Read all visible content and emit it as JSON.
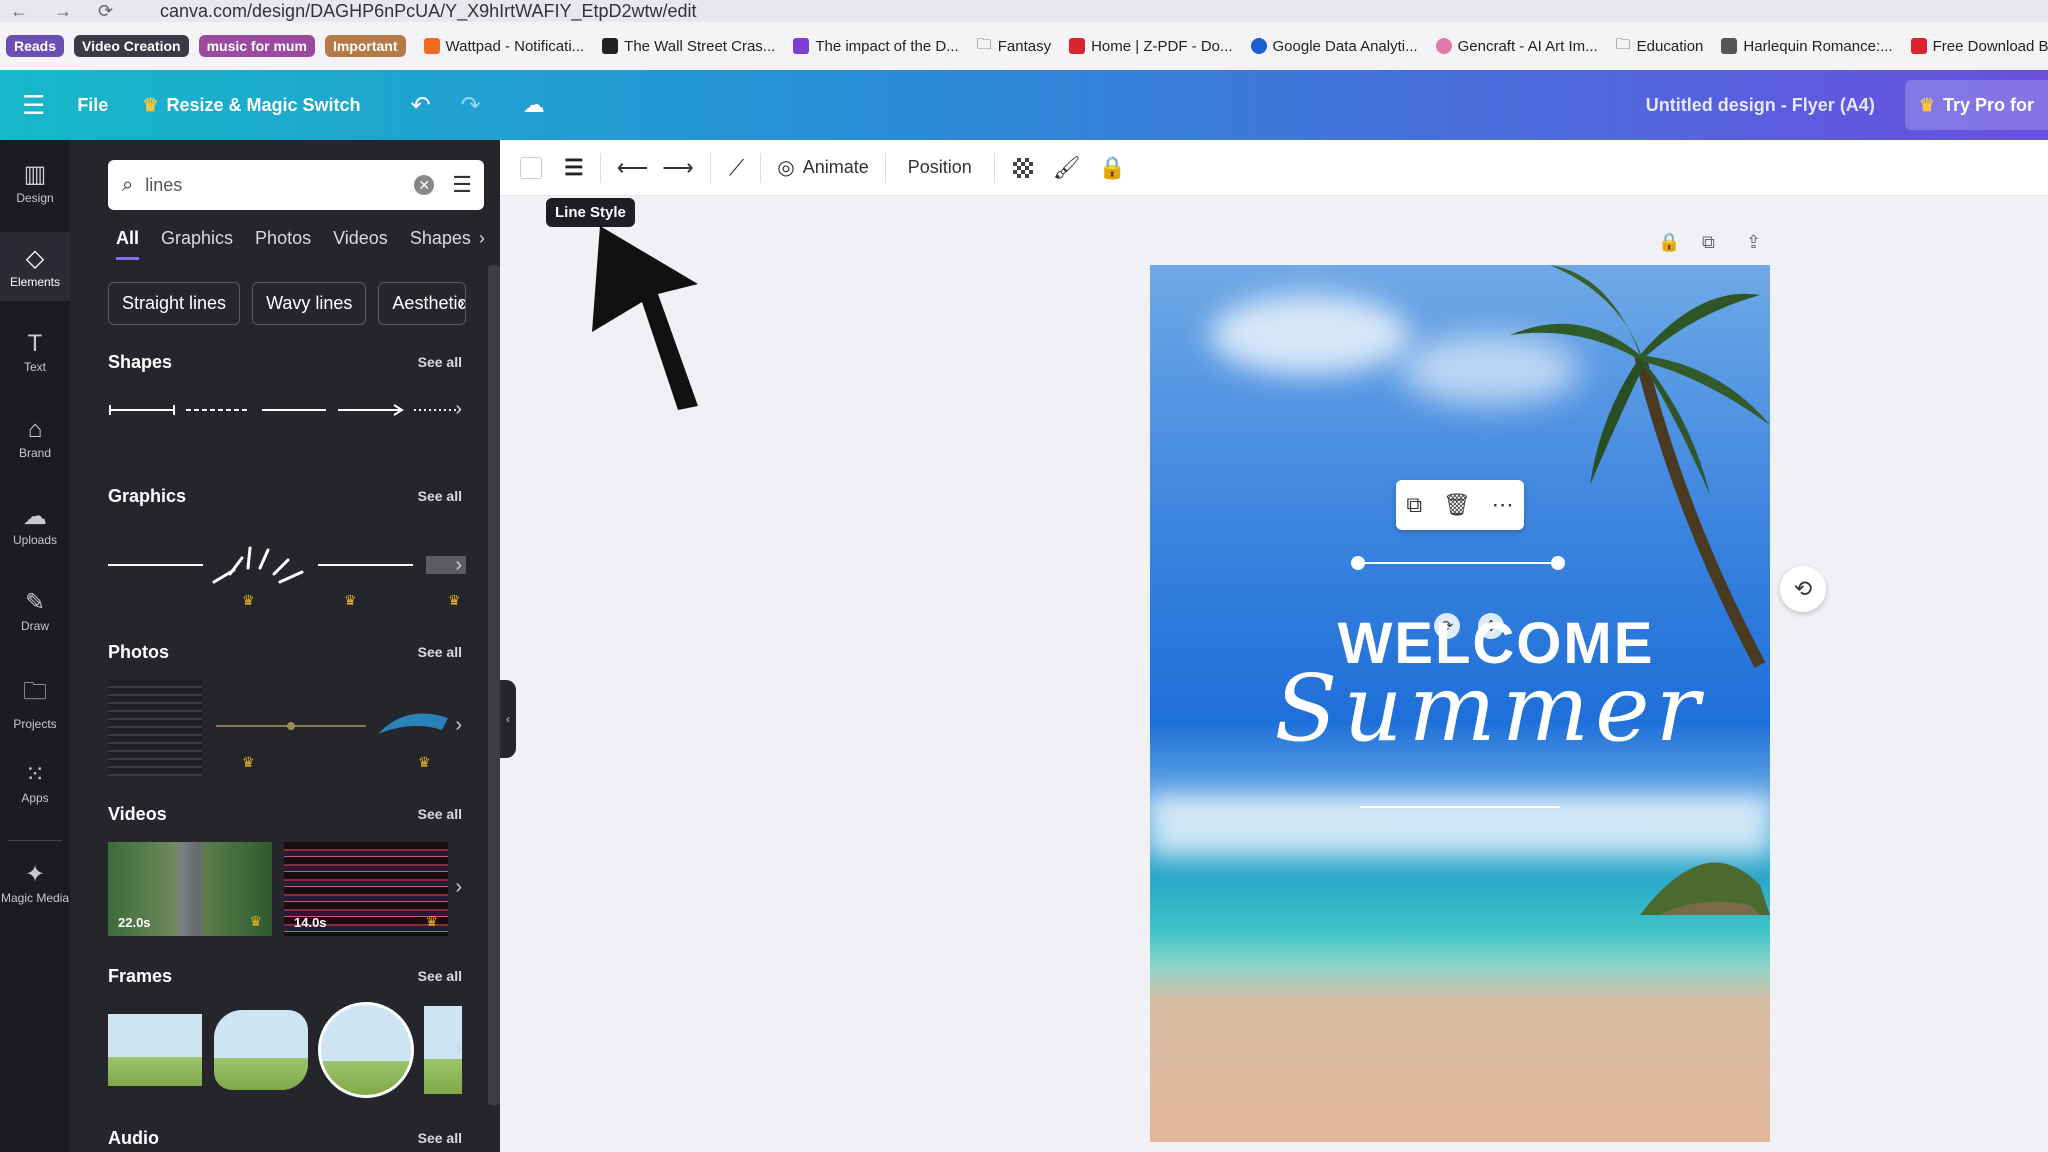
{
  "browser": {
    "url": "canva.com/design/DAGHP6nPcUA/Y_X9hIrtWAFIY_EtpD2wtw/edit",
    "bookmarks_pills": [
      {
        "label": "Reads",
        "color": "#6b4fb3"
      },
      {
        "label": "Video Creation",
        "color": "#3a3a48"
      },
      {
        "label": "music for mum",
        "color": "#9b4a9e"
      },
      {
        "label": "Important",
        "color": "#b57a45"
      }
    ],
    "bookmarks": [
      "Wattpad - Notificati...",
      "The Wall Street Cras...",
      "The impact of the D...",
      "Fantasy",
      "Home | Z-PDF - Do...",
      "Google Data Analyti...",
      "Gencraft - AI Art Im...",
      "Education",
      "Harlequin Romance:...",
      "Free Download Boo"
    ]
  },
  "topbar": {
    "file": "File",
    "resize": "Resize & Magic Switch",
    "title": "Untitled design - Flyer (A4)",
    "try_pro": "Try Pro for"
  },
  "rail": [
    {
      "label": "Design",
      "icon": "design-icon"
    },
    {
      "label": "Elements",
      "icon": "elements-icon"
    },
    {
      "label": "Text",
      "icon": "text-icon"
    },
    {
      "label": "Brand",
      "icon": "brand-icon"
    },
    {
      "label": "Uploads",
      "icon": "uploads-icon"
    },
    {
      "label": "Draw",
      "icon": "draw-icon"
    },
    {
      "label": "Projects",
      "icon": "projects-icon"
    },
    {
      "label": "Apps",
      "icon": "apps-icon"
    },
    {
      "label": "Magic Media",
      "icon": "magic-media-icon"
    }
  ],
  "panel": {
    "search_value": "lines",
    "tabs": [
      "All",
      "Graphics",
      "Photos",
      "Videos",
      "Shapes"
    ],
    "chips": [
      "Straight lines",
      "Wavy lines",
      "Aesthetic"
    ],
    "see_all": "See all",
    "sections": {
      "shapes": "Shapes",
      "graphics": "Graphics",
      "photos": "Photos",
      "videos": "Videos",
      "frames": "Frames",
      "audio": "Audio"
    },
    "video_durations": [
      "22.0s",
      "14.0s"
    ]
  },
  "toolbar": {
    "animate": "Animate",
    "position": "Position",
    "tooltip": "Line Style"
  },
  "poster": {
    "welcome": "WELCOME",
    "summer": "Summer"
  }
}
